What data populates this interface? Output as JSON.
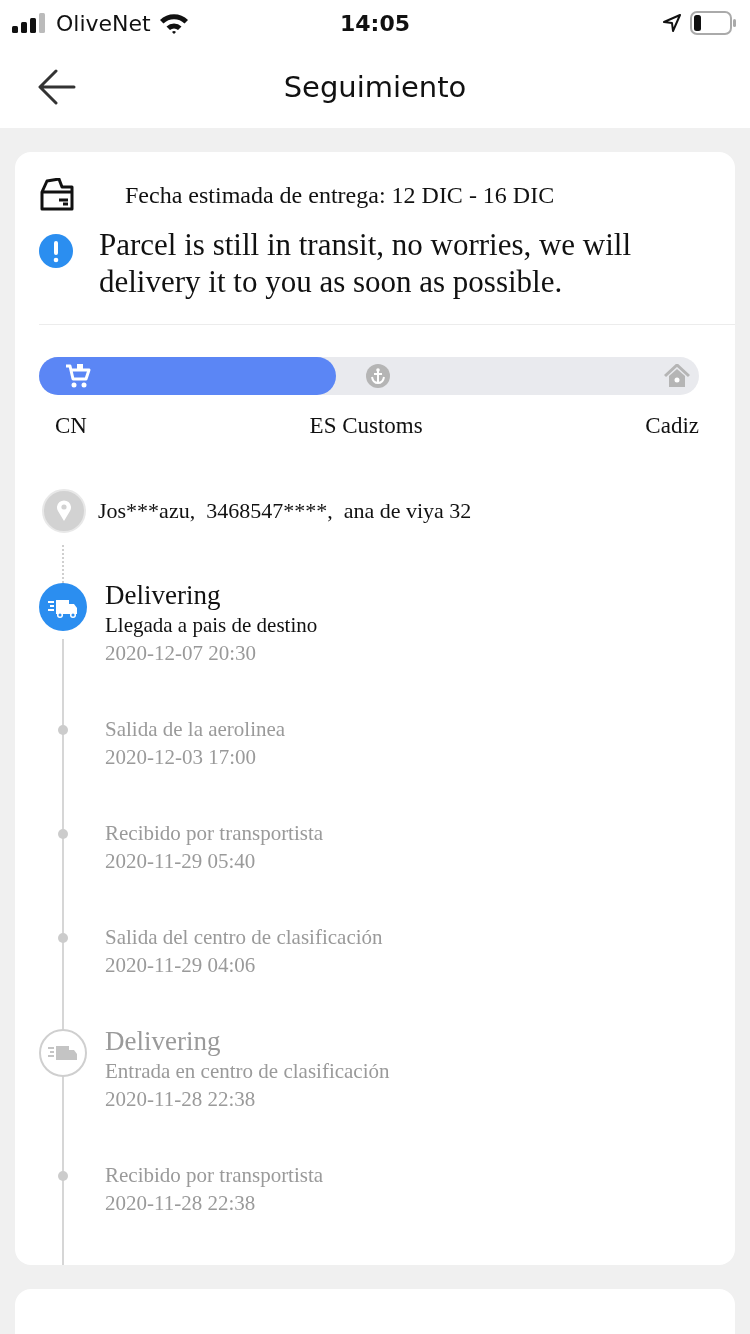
{
  "status_bar": {
    "carrier": "OliveNet",
    "time": "14:05"
  },
  "header": {
    "title": "Seguimiento"
  },
  "delivery": {
    "estimate": "Fecha estimada de entrega: 12 DIC - 16 DIC",
    "notice": "Parcel is still in transit, no worries, we will delivery it to you as soon as possible."
  },
  "progress": {
    "level": 0.45,
    "stages": [
      {
        "label": "CN",
        "kind": "cart"
      },
      {
        "label": "ES Customs",
        "kind": "anchor"
      },
      {
        "label": "Cadiz",
        "kind": "home"
      }
    ]
  },
  "address": "Jos***azu,  3468547****,  ana de viya 32",
  "events": [
    {
      "kind": "milestone",
      "current": true,
      "title": "Delivering",
      "detail": "Llegada a pais de destino",
      "time": "2020-12-07 20:30"
    },
    {
      "kind": "step",
      "current": false,
      "detail": "Salida de la aerolinea",
      "time": "2020-12-03 17:00"
    },
    {
      "kind": "step",
      "current": false,
      "detail": "Recibido por transportista",
      "time": "2020-11-29 05:40"
    },
    {
      "kind": "step",
      "current": false,
      "detail": "Salida del centro de clasificación",
      "time": "2020-11-29 04:06"
    },
    {
      "kind": "milestone",
      "current": false,
      "title": "Delivering",
      "detail": "Entrada en centro de clasificación",
      "time": "2020-11-28 22:38"
    },
    {
      "kind": "step",
      "current": false,
      "detail": "Recibido por transportista",
      "time": "2020-11-28 22:38"
    }
  ]
}
